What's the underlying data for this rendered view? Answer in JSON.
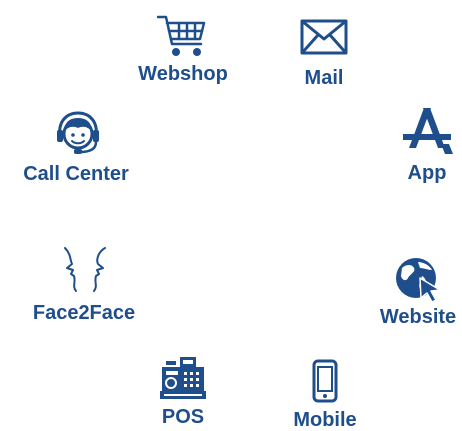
{
  "colors": {
    "primary": "#1f4e8c",
    "background": "#ffffff"
  },
  "channels": [
    {
      "id": "webshop",
      "label": "Webshop",
      "icon": "shopping-cart-icon"
    },
    {
      "id": "mail",
      "label": "Mail",
      "icon": "envelope-icon"
    },
    {
      "id": "app",
      "label": "App",
      "icon": "app-store-icon"
    },
    {
      "id": "website",
      "label": "Website",
      "icon": "globe-cursor-icon"
    },
    {
      "id": "mobile",
      "label": "Mobile",
      "icon": "mobile-phone-icon"
    },
    {
      "id": "pos",
      "label": "POS",
      "icon": "cash-register-icon"
    },
    {
      "id": "face2face",
      "label": "Face2Face",
      "icon": "two-faces-icon"
    },
    {
      "id": "call-center",
      "label": "Call Center",
      "icon": "headset-agent-icon"
    }
  ]
}
